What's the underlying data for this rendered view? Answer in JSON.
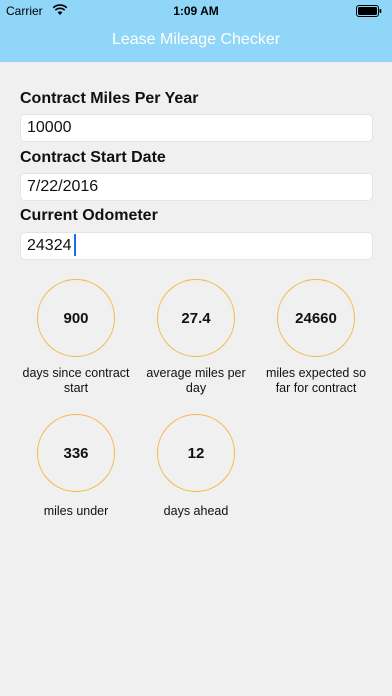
{
  "status_bar": {
    "carrier": "Carrier",
    "time": "1:09 AM"
  },
  "nav": {
    "title": "Lease Mileage Checker"
  },
  "form": {
    "miles_per_year": {
      "label": "Contract Miles Per Year",
      "value": "10000"
    },
    "start_date": {
      "label": "Contract Start Date",
      "value": "7/22/2016"
    },
    "odometer": {
      "label": "Current Odometer",
      "value": "24324"
    }
  },
  "stats": [
    {
      "value": "900",
      "caption": "days since contract start"
    },
    {
      "value": "27.4",
      "caption": "average miles per day"
    },
    {
      "value": "24660",
      "caption": "miles expected so far for contract"
    },
    {
      "value": "336",
      "caption": "miles under"
    },
    {
      "value": "12",
      "caption": "days ahead"
    }
  ],
  "colors": {
    "header": "#8fd6f9",
    "ring": "#f4b948",
    "background": "#f0f0f0"
  }
}
